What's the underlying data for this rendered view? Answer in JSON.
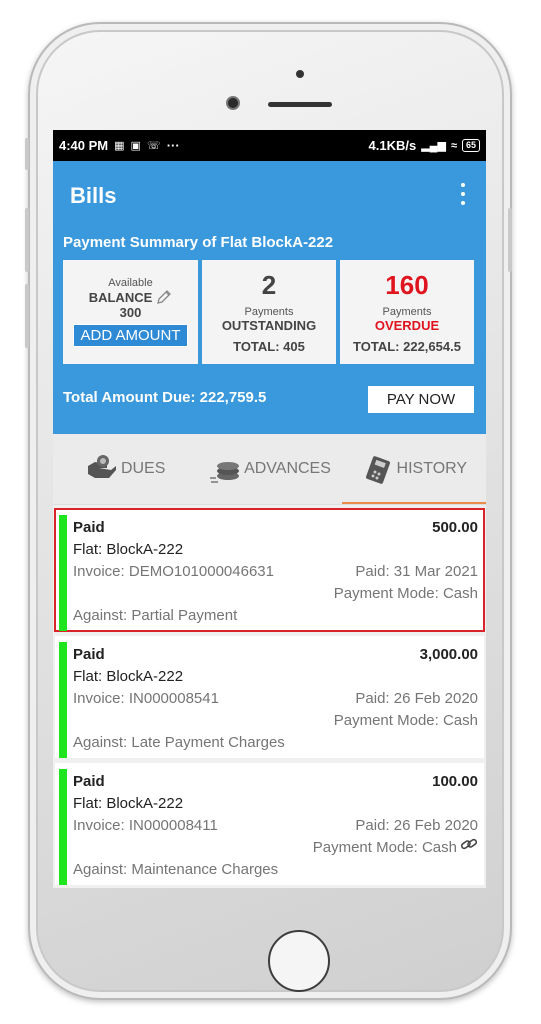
{
  "status_bar": {
    "time": "4:40 PM",
    "dots": "···",
    "speed": "4.1KB/s",
    "battery": "65"
  },
  "header": {
    "title": "Bills",
    "summary_title": "Payment Summary of Flat BlockA-222"
  },
  "cards": {
    "balance": {
      "available_label": "Available",
      "balance_label": "BALANCE",
      "balance_value": "300",
      "add_amount_label": "ADD AMOUNT"
    },
    "outstanding": {
      "count": "2",
      "payments_label": "Payments",
      "status_label": "OUTSTANDING",
      "total": "TOTAL: 405"
    },
    "overdue": {
      "count": "160",
      "payments_label": "Payments",
      "status_label": "OVERDUE",
      "total": "TOTAL: 222,654.5"
    }
  },
  "total_due": "Total Amount Due: 222,759.5",
  "pay_now_label": "PAY NOW",
  "tabs": [
    {
      "label": "DUES",
      "icon": "dues-icon"
    },
    {
      "label": "ADVANCES",
      "icon": "advances-icon"
    },
    {
      "label": "HISTORY",
      "icon": "history-icon",
      "active": true
    }
  ],
  "bills": [
    {
      "status": "Paid",
      "amount": "500.00",
      "flat": "Flat: BlockA-222",
      "invoice": "Invoice: DEMO101000046631",
      "paid_date": "Paid: 31 Mar 2021",
      "payment_mode": "Payment Mode: Cash",
      "against": "Against: Partial Payment"
    },
    {
      "status": "Paid",
      "amount": "3,000.00",
      "flat": "Flat: BlockA-222",
      "invoice": "Invoice: IN000008541",
      "paid_date": "Paid: 26 Feb 2020",
      "payment_mode": "Payment Mode: Cash",
      "against": "Against: Late Payment Charges"
    },
    {
      "status": "Paid",
      "amount": "100.00",
      "flat": "Flat: BlockA-222",
      "invoice": "Invoice: IN000008411",
      "paid_date": "Paid: 26 Feb 2020",
      "payment_mode": "Payment Mode: Cash",
      "against": "Against: Maintenance Charges"
    }
  ],
  "colors": {
    "header_blue": "#3a98dc",
    "paid_green": "#1ee51e",
    "overdue_red": "#e0141e",
    "selected_outline": "#d9232b",
    "tab_indicator": "#e98c4a"
  }
}
